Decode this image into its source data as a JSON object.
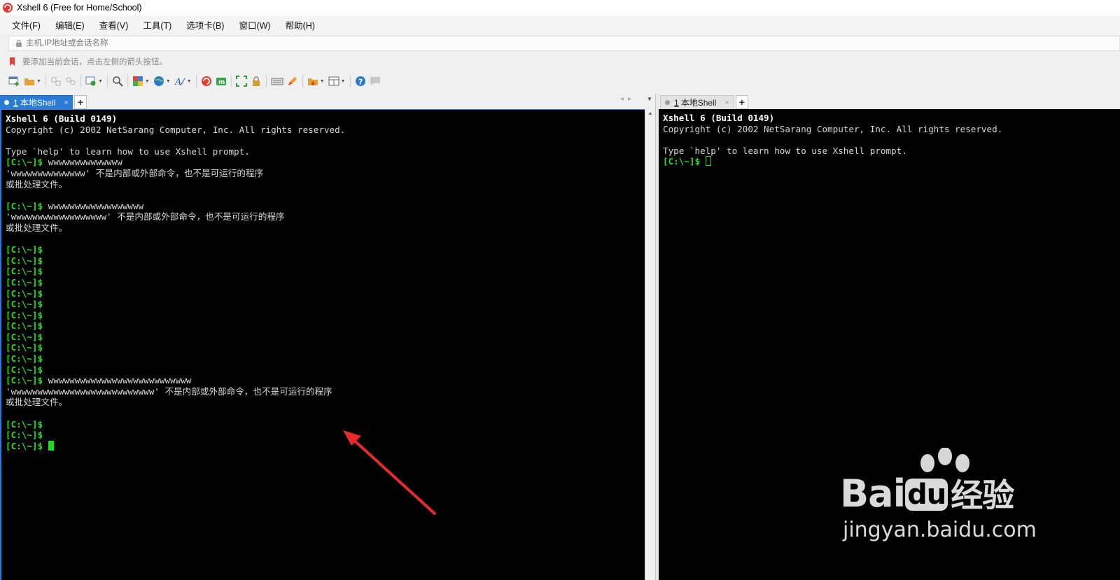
{
  "window": {
    "title": "Xshell 6 (Free for Home/School)"
  },
  "menu": [
    "文件(F)",
    "编辑(E)",
    "查看(V)",
    "工具(T)",
    "选项卡(B)",
    "窗口(W)",
    "帮助(H)"
  ],
  "address": {
    "placeholder": "主机,IP地址或会话名称"
  },
  "hint": "要添加当前会话，点击左侧的箭头按钮。",
  "left_tab": {
    "number": "1",
    "label": "本地Shell",
    "close": "×"
  },
  "right_tab": {
    "number": "1",
    "label": "本地Shell",
    "close": "×"
  },
  "add_tab": "+",
  "terminal_left": {
    "header1": "Xshell 6 (Build 0149)",
    "header2": "Copyright (c) 2002 NetSarang Computer, Inc. All rights reserved.",
    "help": "Type `help' to learn how to use Xshell prompt.",
    "prompt": "[C:\\~]$",
    "cmd1": "wwwwwwwwwwwwww",
    "err1": "'wwwwwwwwwwwwww' 不是内部或外部命令，也不是可运行的程序",
    "err_tail": "或批处理文件。",
    "cmd2": "wwwwwwwwwwwwwwwwww",
    "err2": "'wwwwwwwwwwwwwwwwww' 不是内部或外部命令，也不是可运行的程序",
    "cmd3": "wwwwwwwwwwwwwwwwwwwwwwwwwww",
    "err3": "'wwwwwwwwwwwwwwwwwwwwwwwwwww' 不是内部或外部命令，也不是可运行的程序"
  },
  "terminal_right": {
    "header1": "Xshell 6 (Build 0149)",
    "header2": "Copyright (c) 2002 NetSarang Computer, Inc. All rights reserved.",
    "help": "Type `help' to learn how to use Xshell prompt.",
    "prompt": "[C:\\~]$"
  },
  "watermark": {
    "brand": "Bai",
    "brand_du": "du",
    "brand_cn": "经验",
    "url": "jingyan.baidu.com"
  },
  "colors": {
    "prompt": "#1fe61f",
    "active_tab": "#2a7bd6",
    "terminal_bg": "#000000",
    "annotation_arrow": "#e82a2a"
  }
}
